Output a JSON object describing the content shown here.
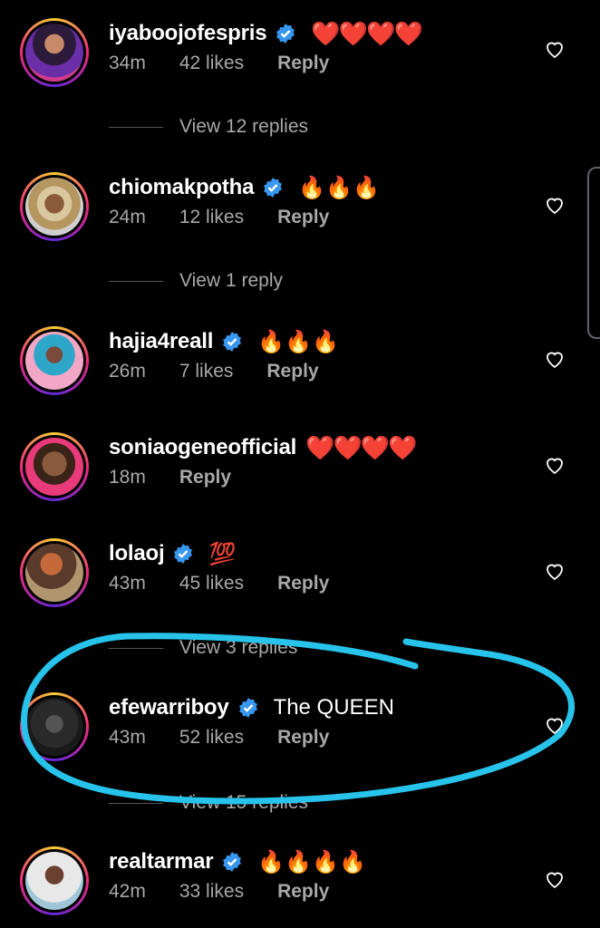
{
  "comments": [
    {
      "username": "iyaboojofespris",
      "verified": true,
      "text": "❤️❤️❤️❤️",
      "time": "34m",
      "likes": "42 likes",
      "reply": "Reply",
      "view_replies": "View 12 replies"
    },
    {
      "username": "chiomakpotha",
      "verified": true,
      "text": "🔥🔥🔥",
      "time": "24m",
      "likes": "12 likes",
      "reply": "Reply",
      "view_replies": "View 1 reply"
    },
    {
      "username": "hajia4reall",
      "verified": true,
      "text": "🔥🔥🔥",
      "time": "26m",
      "likes": "7 likes",
      "reply": "Reply",
      "view_replies": ""
    },
    {
      "username": "soniaogeneofficial",
      "verified": false,
      "text": "❤️❤️❤️❤️",
      "time": "18m",
      "likes": "",
      "reply": "Reply",
      "view_replies": ""
    },
    {
      "username": "lolaoj",
      "verified": true,
      "text": "💯",
      "time": "43m",
      "likes": "45 likes",
      "reply": "Reply",
      "view_replies": "View 3 replies"
    },
    {
      "username": "efewarriboy",
      "verified": true,
      "text": "The QUEEN",
      "time": "43m",
      "likes": "52 likes",
      "reply": "Reply",
      "view_replies": "View 15 replies"
    },
    {
      "username": "realtarmar",
      "verified": true,
      "text": "🔥🔥🔥🔥",
      "time": "42m",
      "likes": "33 likes",
      "reply": "Reply",
      "view_replies": ""
    }
  ],
  "colors": {
    "annotation": "#27c3ea",
    "verified": "#3897f0",
    "heart_emoji": "#e0151e",
    "muted": "#a8a8a8"
  },
  "icons": {
    "verified": "verified-badge-icon",
    "like": "heart-outline-icon"
  }
}
